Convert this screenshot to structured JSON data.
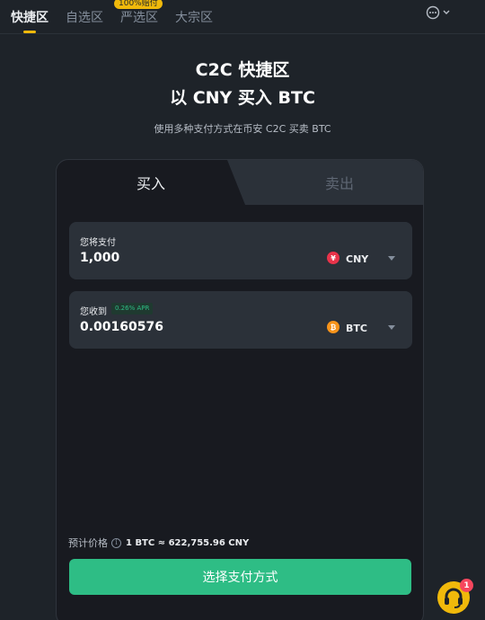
{
  "nav": {
    "tabs": [
      {
        "label": "快捷区",
        "active": true
      },
      {
        "label": "自选区",
        "active": false
      },
      {
        "label": "严选区",
        "active": false,
        "badge": "100%赔付"
      },
      {
        "label": "大宗区",
        "active": false
      }
    ],
    "more_icon": "more-horizontal-circle-icon"
  },
  "hero": {
    "title_line1": "C2C 快捷区",
    "title_line2": "以 CNY 买入 BTC",
    "subtitle": "使用多种支付方式在币安 C2C 买卖 BTC"
  },
  "trade": {
    "tab_buy": "买入",
    "tab_sell": "卖出",
    "pay": {
      "label": "您将支付",
      "amount": "1,000",
      "currency_symbol": "¥",
      "currency": "CNY",
      "icon_color": "#e8334a"
    },
    "receive": {
      "label": "您收到",
      "apr_badge": "0.26% APR",
      "amount": "0.00160576",
      "currency_symbol": "₿",
      "currency": "BTC",
      "icon_color": "#f7931a"
    },
    "price_label": "预计价格",
    "price_value": "1 BTC ≈ 622,755.96 CNY",
    "cta_label": "选择支付方式"
  },
  "support": {
    "icon": "headset-support-icon",
    "badge_count": "1"
  },
  "colors": {
    "background": "#1e2329",
    "accent": "#f0b90b",
    "buy_green": "#2ebd85",
    "notification_red": "#f6465d"
  }
}
